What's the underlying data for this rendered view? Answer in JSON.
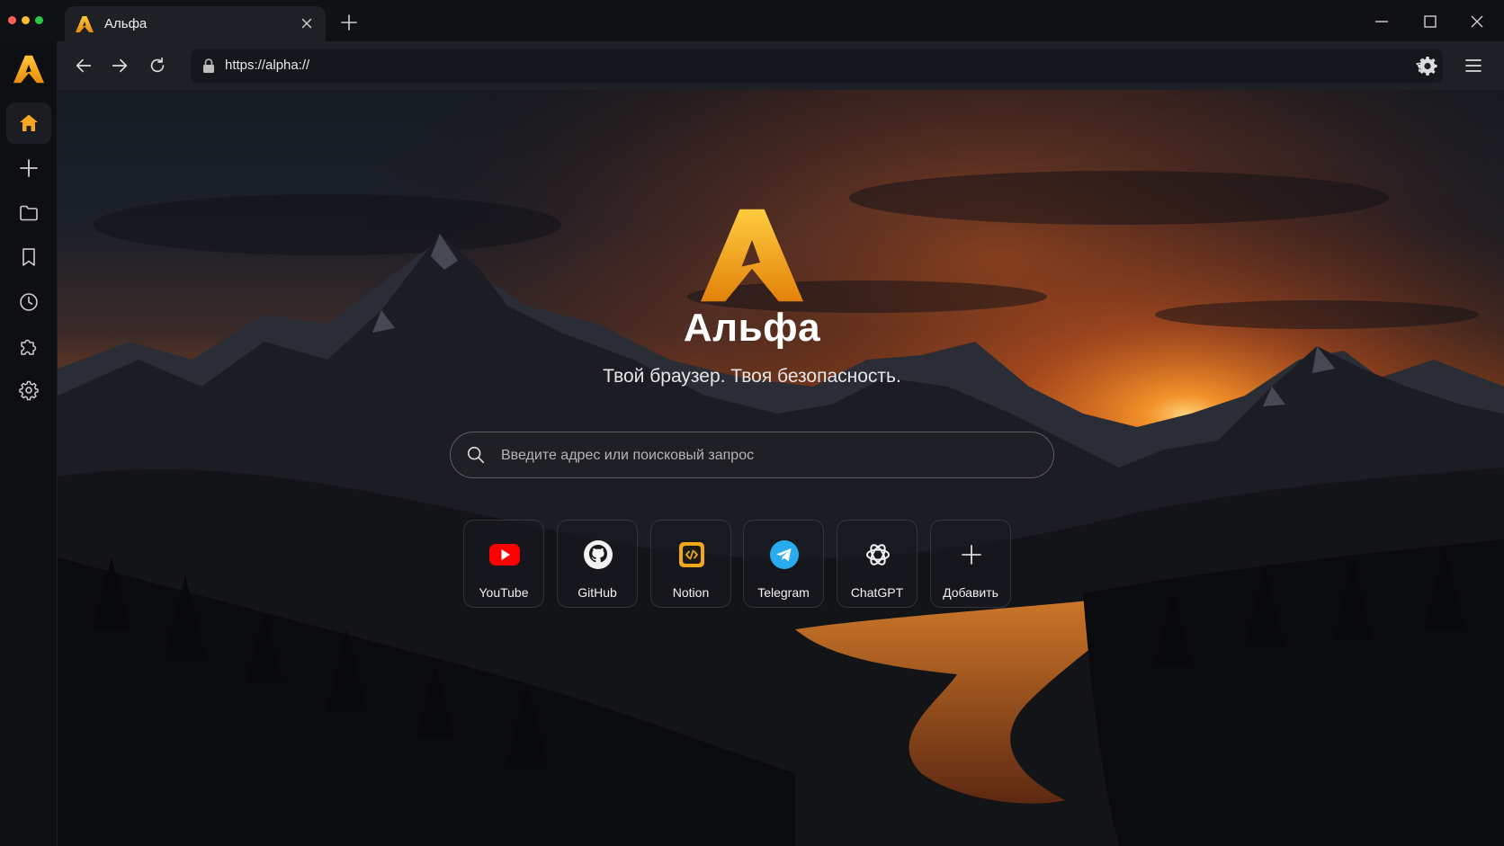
{
  "window": {
    "tab_title": "Альфа",
    "controls": [
      "minimize",
      "maximize",
      "close"
    ]
  },
  "toolbar": {
    "url": "https://alpha://"
  },
  "sidebar": {
    "items": [
      {
        "name": "home",
        "icon": "home-icon",
        "active": true
      },
      {
        "name": "new",
        "icon": "plus-icon"
      },
      {
        "name": "files",
        "icon": "folder-icon"
      },
      {
        "name": "bookmarks",
        "icon": "bookmark-icon"
      },
      {
        "name": "history",
        "icon": "clock-icon"
      },
      {
        "name": "extensions",
        "icon": "puzzle-icon"
      },
      {
        "name": "settings",
        "icon": "gear-icon"
      }
    ]
  },
  "hero": {
    "title": "Альфа",
    "subtitle": "Твой браузер. Твоя безопасность."
  },
  "search": {
    "placeholder": "Введите адрес или поисковый запрос",
    "value": ""
  },
  "shortcuts": [
    {
      "label": "YouTube",
      "icon": "youtube-icon"
    },
    {
      "label": "GitHub",
      "icon": "github-icon"
    },
    {
      "label": "Notion",
      "icon": "notion-icon"
    },
    {
      "label": "Telegram",
      "icon": "telegram-icon"
    },
    {
      "label": "ChatGPT",
      "icon": "chatgpt-icon"
    },
    {
      "label": "Добавить",
      "icon": "plus-icon"
    }
  ],
  "colors": {
    "accent": "#f5a623",
    "youtube": "#ff0000",
    "telegram": "#2aabee",
    "notion": "#f0a818"
  }
}
